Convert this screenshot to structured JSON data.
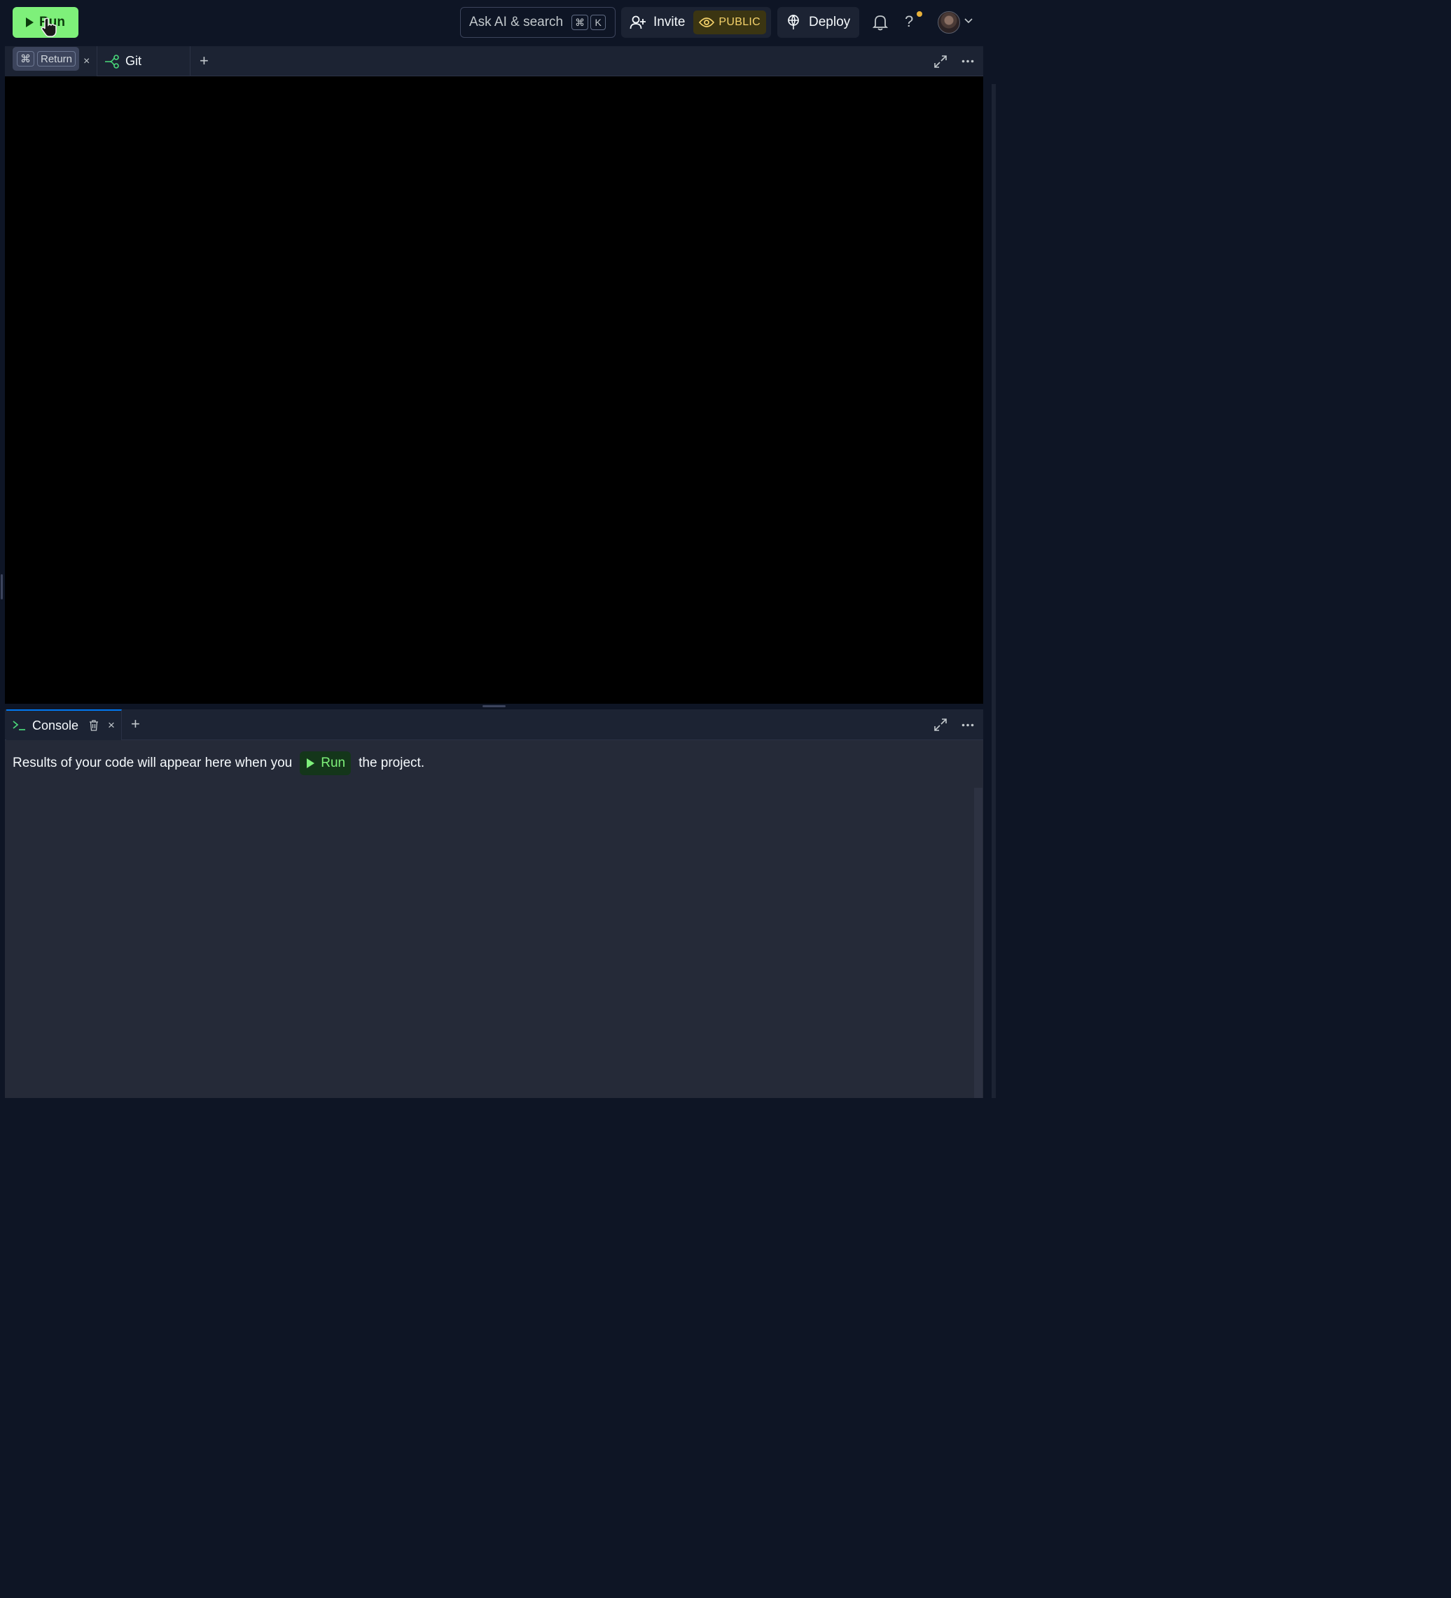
{
  "toolbar": {
    "run_label": "Run",
    "search_label": "Ask AI & search",
    "search_shortcut": [
      "⌘",
      "K"
    ],
    "invite_label": "Invite",
    "visibility_label": "PUBLIC",
    "deploy_label": "Deploy",
    "help_label": "?"
  },
  "upper_pane": {
    "tooltip_keys": [
      "⌘",
      "Return"
    ],
    "tabs": [
      {
        "label": "Git",
        "icon": "git-branch-icon"
      }
    ],
    "close_glyph": "×",
    "add_glyph": "+"
  },
  "console": {
    "tab_label": "Console",
    "message_before": "Results of your code will appear here when you",
    "inline_run_label": "Run",
    "message_after": "the project.",
    "add_glyph": "+",
    "close_glyph": "×"
  },
  "colors": {
    "run_green": "#7ef07a",
    "accent_blue": "#0079f2",
    "public_yellow": "#f6d36b",
    "background": "#0e1525",
    "panel": "#1c2333"
  }
}
